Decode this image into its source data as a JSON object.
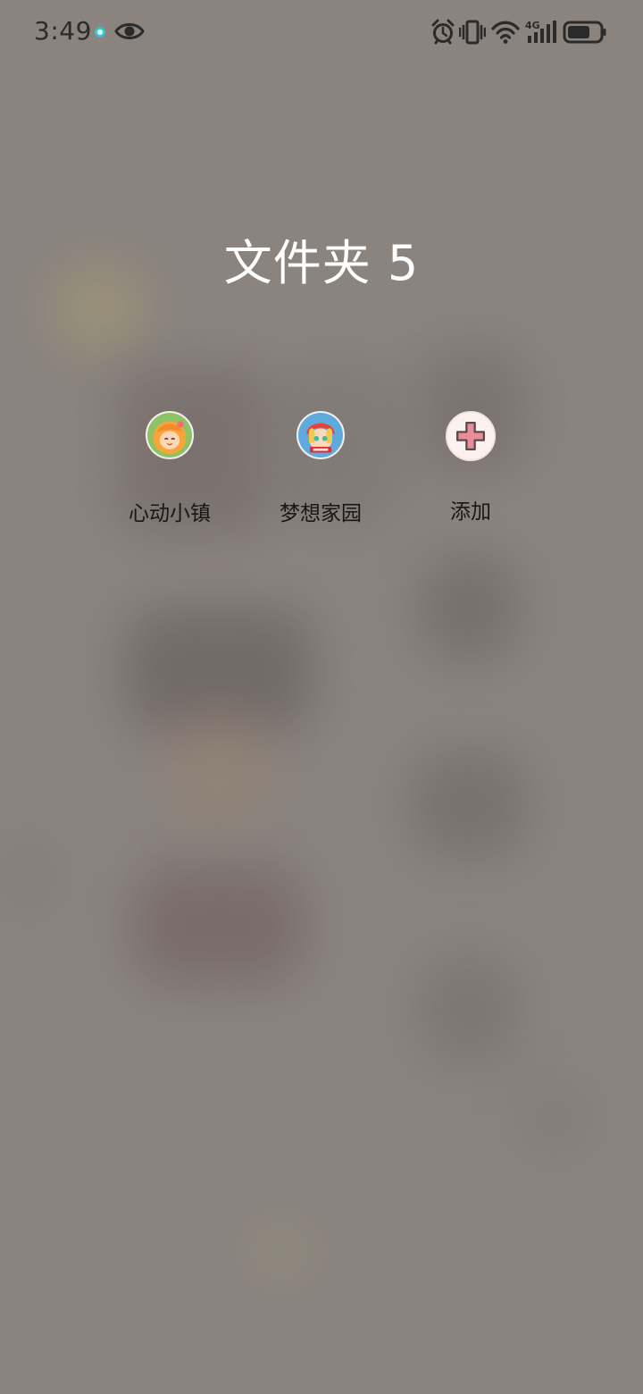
{
  "status_bar": {
    "time": "3:49",
    "icons": [
      "notification-dot-icon",
      "eye-icon",
      "alarm-icon",
      "vibrate-icon",
      "wifi-icon",
      "4g-signal-icon",
      "battery-icon"
    ]
  },
  "folder": {
    "title": "文件夹 5",
    "apps": [
      {
        "label": "心动小镇",
        "icon": "heartbeat-town-app-icon"
      },
      {
        "label": "梦想家园",
        "icon": "dream-home-app-icon"
      },
      {
        "label": "添加",
        "icon": "add-plus-icon"
      }
    ]
  },
  "colors": {
    "backdrop": "#8a837e",
    "title_text": "#ffffff",
    "label_text": "#171717",
    "add_icon_cross": "#e98d96"
  }
}
